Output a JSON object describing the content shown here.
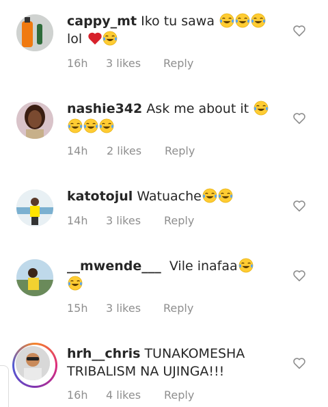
{
  "comments": [
    {
      "username": "cappy_mt",
      "text": "Iko tu sawa",
      "emojis_after_text": 3,
      "line2": "lol",
      "line2_red_heart": true,
      "line2_emojis": 1,
      "time": "16h",
      "likes": "3 likes",
      "reply": "Reply"
    },
    {
      "username": "nashie342",
      "text": "Ask me about it",
      "emojis_after_text": 1,
      "line2": "",
      "line2_emojis": 3,
      "time": "14h",
      "likes": "2 likes",
      "reply": "Reply"
    },
    {
      "username": "katotojul",
      "text": "Watuache",
      "emojis_after_text": 2,
      "line2": "",
      "line2_emojis": 0,
      "time": "14h",
      "likes": "3 likes",
      "reply": "Reply"
    },
    {
      "username": "__mwende___",
      "text": "Vile inafaa",
      "emojis_after_text": 1,
      "line2": "",
      "line2_emojis": 1,
      "time": "15h",
      "likes": "3 likes",
      "reply": "Reply"
    },
    {
      "username": "hrh__chris",
      "text": "TUNAKOMESHA",
      "line2": "TRIBALISM NA UJINGA!!!",
      "time": "16h",
      "likes": "4 likes",
      "reply": "Reply"
    }
  ],
  "icons": {
    "like": "heart-outline-icon",
    "emoji": "face-with-tears-of-joy-emoji",
    "red_heart": "red-heart-emoji"
  },
  "colors": {
    "meta": "#8e8e8e",
    "text": "#262626",
    "story_ring": "#dd2a7b"
  }
}
